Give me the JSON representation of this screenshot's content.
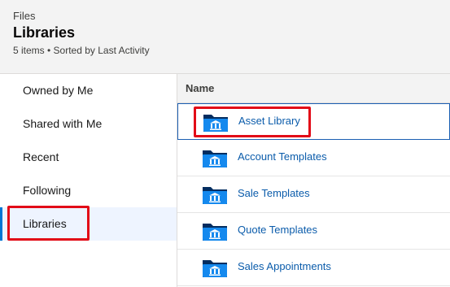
{
  "header": {
    "eyebrow": "Files",
    "title": "Libraries",
    "meta": "5 items • Sorted by Last Activity"
  },
  "sidebar": {
    "items": [
      {
        "label": "Owned by Me"
      },
      {
        "label": "Shared with Me"
      },
      {
        "label": "Recent"
      },
      {
        "label": "Following"
      },
      {
        "label": "Libraries"
      }
    ],
    "active_item": "Libraries"
  },
  "table": {
    "column_header": "Name",
    "rows": [
      {
        "name": "Asset Library",
        "icon": "library-folder-icon"
      },
      {
        "name": "Account Templates",
        "icon": "library-folder-icon"
      },
      {
        "name": "Sale Templates",
        "icon": "library-folder-icon"
      },
      {
        "name": "Quote Templates",
        "icon": "library-folder-icon"
      },
      {
        "name": "Sales Appointments",
        "icon": "library-folder-icon"
      }
    ]
  },
  "colors": {
    "accent": "#0176d3",
    "link": "#0b5cab",
    "highlight": "#e20a17",
    "folder_dark": "#032d60",
    "folder_light": "#1589ee"
  }
}
